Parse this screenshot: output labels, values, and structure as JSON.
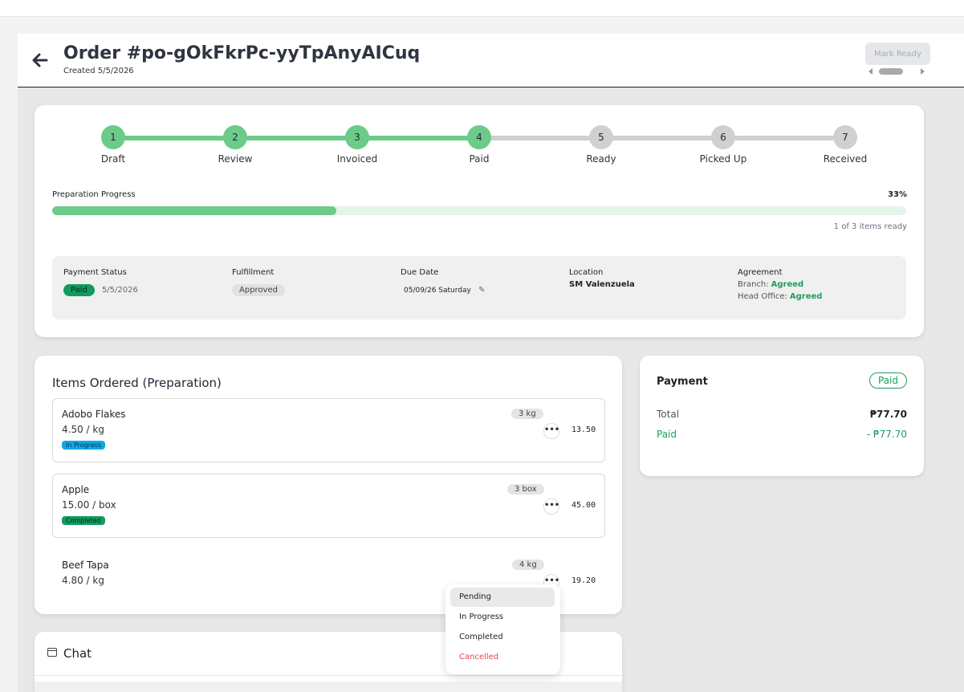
{
  "header": {
    "title": "Order #po-gOkFkrPc-yyTpAnyAICuq",
    "created": "Created 5/5/2026",
    "mark_ready_label": "Mark Ready"
  },
  "steps": [
    {
      "num": "1",
      "label": "Draft",
      "done": true
    },
    {
      "num": "2",
      "label": "Review",
      "done": true
    },
    {
      "num": "3",
      "label": "Invoiced",
      "done": true
    },
    {
      "num": "4",
      "label": "Paid",
      "done": true
    },
    {
      "num": "5",
      "label": "Ready",
      "done": false
    },
    {
      "num": "6",
      "label": "Picked Up",
      "done": false
    },
    {
      "num": "7",
      "label": "Received",
      "done": false
    }
  ],
  "progress": {
    "label": "Preparation Progress",
    "percent_text": "33%",
    "fraction": 0.333,
    "note": "1 of 3 items ready"
  },
  "info": {
    "payment_status": {
      "heading": "Payment Status",
      "badge": "Paid",
      "date": "5/5/2026"
    },
    "fulfillment": {
      "heading": "Fulfillment",
      "badge": "Approved"
    },
    "due_date": {
      "heading": "Due Date",
      "value": "05/09/26 Saturday"
    },
    "location": {
      "heading": "Location",
      "value": "SM Valenzuela"
    },
    "agreement": {
      "heading": "Agreement",
      "branch_label": "Branch:",
      "branch_value": "Agreed",
      "head_label": "Head Office:",
      "head_value": "Agreed"
    }
  },
  "items": {
    "title": "Items Ordered (Preparation)",
    "list": [
      {
        "name": "Adobo Flakes",
        "price": "4.50 / kg",
        "status": "In Progress",
        "qty": "3 kg",
        "total": "13.50"
      },
      {
        "name": "Apple",
        "price": "15.00 / box",
        "status": "Completed",
        "qty": "3 box",
        "total": "45.00"
      },
      {
        "name": "Beef Tapa",
        "price": "4.80 / kg",
        "status": "",
        "qty": "4 kg",
        "total": "19.20"
      }
    ]
  },
  "payment": {
    "title": "Payment",
    "badge": "Paid",
    "total_label": "Total",
    "total_value": "₱77.70",
    "paid_label": "Paid",
    "paid_value": "- ₱77.70"
  },
  "chat": {
    "title": "Chat"
  },
  "status_menu": {
    "options": [
      "Pending",
      "In Progress",
      "Completed",
      "Cancelled"
    ]
  },
  "colors": {
    "accent_green": "#6ccb88",
    "inactive_grey": "#d0d0d0",
    "paid_green": "#1f9d5c",
    "danger": "#e04848"
  },
  "icons": {
    "back": "arrow-left-icon",
    "edit": "pencil-icon",
    "more": "more-horizontal-icon",
    "chat": "chat-icon"
  }
}
